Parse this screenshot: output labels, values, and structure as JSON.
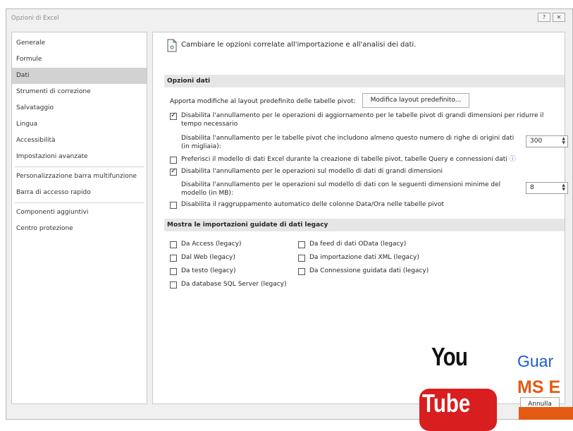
{
  "window": {
    "title": "Opzioni di Excel",
    "help_button": "?",
    "close_button": "✕"
  },
  "sidebar": {
    "items": [
      {
        "label": "Generale",
        "selected": false
      },
      {
        "label": "Formule",
        "selected": false
      },
      {
        "label": "Dati",
        "selected": true
      },
      {
        "label": "Strumenti di correzione",
        "selected": false
      },
      {
        "label": "Salvataggio",
        "selected": false
      },
      {
        "label": "Lingua",
        "selected": false
      },
      {
        "label": "Accessibilità",
        "selected": false
      },
      {
        "label": "Impostazioni avanzate",
        "selected": false
      },
      {
        "label": "Personalizzazione barra multifunzione",
        "selected": false
      },
      {
        "label": "Barra di accesso rapido",
        "selected": false
      },
      {
        "label": "Componenti aggiuntivi",
        "selected": false
      },
      {
        "label": "Centro protezione",
        "selected": false
      }
    ]
  },
  "main": {
    "header": "Cambiare le opzioni correlate all'importazione e all'analisi dei dati.",
    "header_icon": "document-data-icon",
    "section1": {
      "title": "Opzioni dati",
      "layout_label": "Apporta modifiche al layout predefinito delle tabelle pivot:",
      "layout_button": "Modifica layout predefinito...",
      "opt1": {
        "checked": true,
        "line1": "Disabilita l'annullamento per le operazioni di aggiornamento per le tabelle pivot di grandi dimensioni per ridurre il",
        "line2": "tempo necessario"
      },
      "opt1_sub": {
        "line1": "Disabilita l'annullamento per le tabelle pivot che includono almeno questo numero di righe di origini dati",
        "line2": "(in migliaia):",
        "value": "300"
      },
      "opt2": {
        "checked": false,
        "label": "Preferisci il modello di dati Excel durante la creazione di tabelle pivot, tabelle Query e connessioni dati"
      },
      "opt3": {
        "checked": true,
        "label": "Disabilita l'annullamento per le operazioni sul modello di dati di grandi dimensioni"
      },
      "opt3_sub": {
        "line1": "Disabilita l'annullamento per le operazioni sul modello di dati con le seguenti dimensioni minime del",
        "line2": "modello (in MB):",
        "value": "8"
      },
      "opt4": {
        "checked": false,
        "label": "Disabilita il raggruppamento automatico delle colonne Data/Ora nelle tabelle pivot"
      }
    },
    "section2": {
      "title": "Mostra le importazioni guidate di dati legacy",
      "col1": [
        {
          "label": "Da Access (legacy)",
          "checked": false
        },
        {
          "label": "Dal Web (legacy)",
          "checked": false
        },
        {
          "label": "Da testo (legacy)",
          "checked": false
        },
        {
          "label": "Da database SQL Server (legacy)",
          "checked": false
        }
      ],
      "col2": [
        {
          "label": "Da feed di dati OData (legacy)",
          "checked": false
        },
        {
          "label": "Da importazione dati XML (legacy)",
          "checked": false
        },
        {
          "label": "Da Connessione guidata dati (legacy)",
          "checked": false
        }
      ]
    }
  },
  "footer": {
    "cancel_button": "Annulla"
  },
  "overlay": {
    "you": "You",
    "tube": "Tube",
    "line1": "Guar",
    "line2": "MS E"
  },
  "colors": {
    "selected_nav": "#d2d2d2",
    "section_bg": "#e6e6e6",
    "yt_red": "#d81e1e",
    "overlay_blue": "#1d5bd6",
    "overlay_orange": "#e35b12"
  }
}
